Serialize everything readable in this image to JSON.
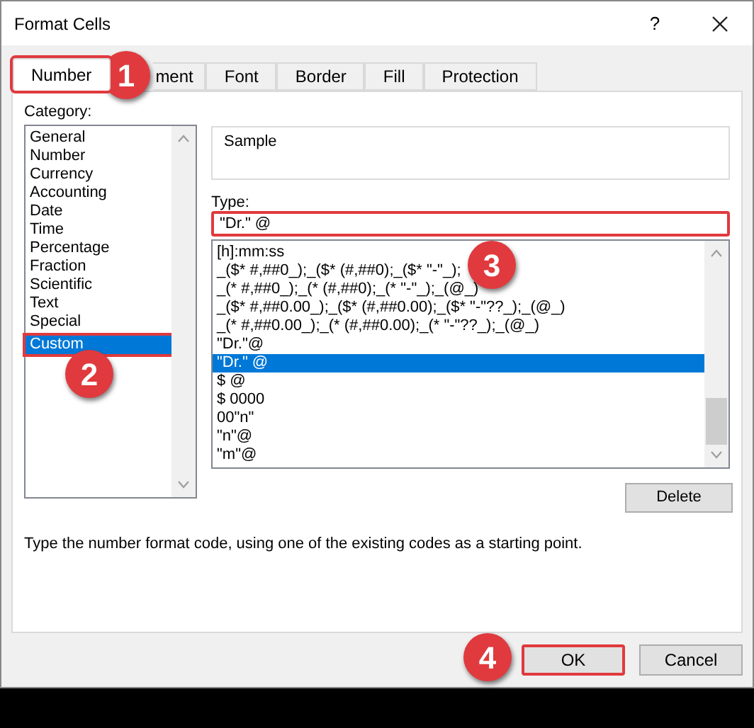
{
  "window": {
    "title": "Format Cells",
    "help": "?"
  },
  "tabs": [
    {
      "label": "Number",
      "selected": true
    },
    {
      "label": "ment",
      "selected": false
    },
    {
      "label": "Font",
      "selected": false
    },
    {
      "label": "Border",
      "selected": false
    },
    {
      "label": "Fill",
      "selected": false
    },
    {
      "label": "Protection",
      "selected": false
    }
  ],
  "category": {
    "label": "Category:",
    "items": [
      {
        "label": "General",
        "selected": false
      },
      {
        "label": "Number",
        "selected": false
      },
      {
        "label": "Currency",
        "selected": false
      },
      {
        "label": "Accounting",
        "selected": false
      },
      {
        "label": "Date",
        "selected": false
      },
      {
        "label": "Time",
        "selected": false
      },
      {
        "label": "Percentage",
        "selected": false
      },
      {
        "label": "Fraction",
        "selected": false
      },
      {
        "label": "Scientific",
        "selected": false
      },
      {
        "label": "Text",
        "selected": false
      },
      {
        "label": "Special",
        "selected": false
      },
      {
        "label": "Custom",
        "selected": true
      }
    ]
  },
  "sample": {
    "label": "Sample"
  },
  "type": {
    "label": "Type:",
    "value": "\"Dr.\" @",
    "items": [
      {
        "label": "[h]:mm:ss",
        "selected": false
      },
      {
        "label": "_($* #,##0_);_($* (#,##0);_($* \"-\"_);",
        "selected": false
      },
      {
        "label": "_(* #,##0_);_(* (#,##0);_(* \"-\"_);_(@_)",
        "selected": false
      },
      {
        "label": "_($* #,##0.00_);_($* (#,##0.00);_($* \"-\"??_);_(@_)",
        "selected": false
      },
      {
        "label": "_(* #,##0.00_);_(* (#,##0.00);_(* \"-\"??_);_(@_)",
        "selected": false
      },
      {
        "label": "\"Dr.\"@",
        "selected": false
      },
      {
        "label": "\"Dr.\" @",
        "selected": true
      },
      {
        "label": "$ @",
        "selected": false
      },
      {
        "label": "$ 0000",
        "selected": false
      },
      {
        "label": "00\"n\"",
        "selected": false
      },
      {
        "label": "\"n\"@",
        "selected": false
      },
      {
        "label": "\"m\"@",
        "selected": false
      }
    ]
  },
  "delete_button": "Delete",
  "description": "Type the number format code, using one of the existing codes as a starting point.",
  "buttons": [
    {
      "label": "OK",
      "kind": "primary"
    },
    {
      "label": "Cancel",
      "kind": "normal"
    }
  ],
  "annotations": [
    {
      "label": "1"
    },
    {
      "label": "2"
    },
    {
      "label": "3"
    },
    {
      "label": "4"
    }
  ]
}
